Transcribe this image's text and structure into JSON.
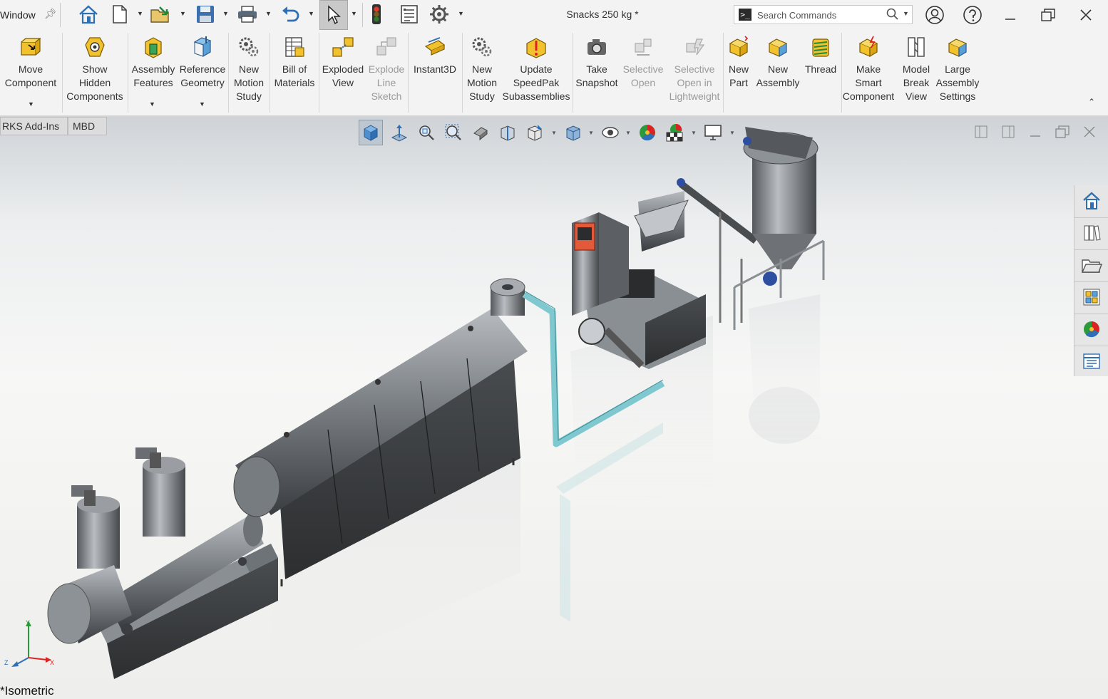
{
  "titlebar": {
    "menu_window": "Window",
    "document_title": "Snacks 250 kg *",
    "search_placeholder": "Search Commands"
  },
  "ribbon": {
    "buttons": [
      {
        "label": "Move\nComponent",
        "enabled": true
      },
      {
        "label": "Show\nHidden\nComponents",
        "enabled": true
      },
      {
        "label": "Assembly\nFeatures",
        "enabled": true
      },
      {
        "label": "Reference\nGeometry",
        "enabled": true
      },
      {
        "label": "New\nMotion\nStudy",
        "enabled": true
      },
      {
        "label": "Bill of\nMaterials",
        "enabled": true
      },
      {
        "label": "Exploded\nView",
        "enabled": true
      },
      {
        "label": "Explode\nLine\nSketch",
        "enabled": false
      },
      {
        "label": "Instant3D",
        "enabled": true
      },
      {
        "label": "New\nMotion\nStudy",
        "enabled": true
      },
      {
        "label": "Update\nSpeedPak\nSubassemblies",
        "enabled": true
      },
      {
        "label": "Take\nSnapshot",
        "enabled": true
      },
      {
        "label": "Selective\nOpen",
        "enabled": false
      },
      {
        "label": "Selective\nOpen in\nLightweight",
        "enabled": false
      },
      {
        "label": "New\nPart",
        "enabled": true
      },
      {
        "label": "New\nAssembly",
        "enabled": true
      },
      {
        "label": "Thread",
        "enabled": true
      },
      {
        "label": "Make\nSmart\nComponent",
        "enabled": true
      },
      {
        "label": "Model\nBreak\nView",
        "enabled": true
      },
      {
        "label": "Large\nAssembly\nSettings",
        "enabled": true
      }
    ]
  },
  "tabs": [
    {
      "label": "RKS Add-Ins"
    },
    {
      "label": "MBD"
    }
  ],
  "viewport": {
    "view_name": "*Isometric",
    "triad": {
      "x": "X",
      "y": "Y",
      "z": "Z"
    }
  },
  "colors": {
    "accent_blue": "#2f6fb5",
    "icon_yellow": "#f2c12e",
    "pipe_teal": "#7fc8cf",
    "machine_dark": "#3c3f42",
    "machine_steel": "#8c9196"
  }
}
